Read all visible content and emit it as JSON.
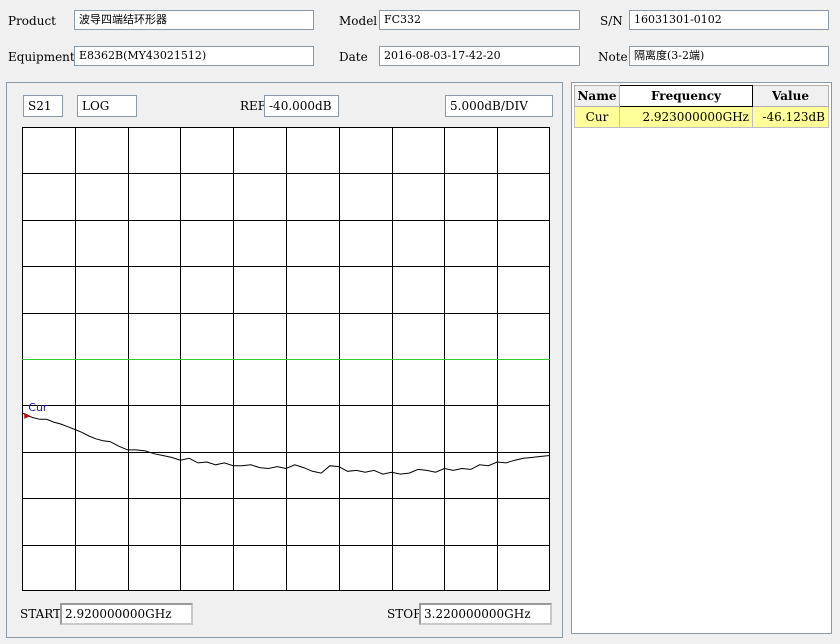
{
  "header": {
    "product_label": "Product",
    "product_value": "波导四端结环形器",
    "model_label": "Model",
    "model_value": "FC332",
    "sn_label": "S/N",
    "sn_value": "16031301-0102",
    "equipment_label": "Equipment",
    "equipment_value": "E8362B(MY43021512)",
    "date_label": "Date",
    "date_value": "2016-08-03-17-42-20",
    "note_label": "Note",
    "note_value": "隔离度(3-2端)"
  },
  "chart_header": {
    "param": "S21",
    "format": "LOG",
    "ref_label": "REF",
    "ref_value": "-40.000dB",
    "scale": "5.000dB/DIV"
  },
  "chart_footer": {
    "start_label": "START",
    "start_value": "2.920000000GHz",
    "stop_label": "STOP",
    "stop_value": "3.220000000GHz"
  },
  "colors": {
    "trace": "#000000",
    "reference_line": "#33cc33",
    "marker": "#cc0000",
    "marker_label": "#1a1ab4",
    "row_highlight": "#ffff99"
  },
  "chart_data": {
    "type": "line",
    "x_unit": "GHz",
    "y_unit": "dB",
    "xlim": [
      2.92,
      3.22
    ],
    "ylim": [
      -65,
      -15
    ],
    "x_divisions": 10,
    "y_divisions": 10,
    "reference_level": -40,
    "grid": true,
    "series": [
      {
        "x": [
          2.92,
          2.923,
          2.926,
          2.93,
          2.934,
          2.938,
          2.942,
          2.946,
          2.95,
          2.954,
          2.958,
          2.962,
          2.966,
          2.97,
          2.975,
          2.98,
          2.985,
          2.99,
          2.995,
          3.0,
          3.005,
          3.01,
          3.015,
          3.02,
          3.025,
          3.03,
          3.035,
          3.04,
          3.045,
          3.05,
          3.055,
          3.06,
          3.065,
          3.07,
          3.075,
          3.08,
          3.085,
          3.09,
          3.095,
          3.1,
          3.105,
          3.11,
          3.115,
          3.12,
          3.125,
          3.13,
          3.135,
          3.14,
          3.145,
          3.15,
          3.155,
          3.16,
          3.165,
          3.17,
          3.175,
          3.18,
          3.185,
          3.19,
          3.195,
          3.2,
          3.205,
          3.21,
          3.215,
          3.22
        ],
        "values": [
          -45.8,
          -46.1,
          -46.3,
          -46.5,
          -46.5,
          -46.8,
          -47.0,
          -47.3,
          -47.6,
          -47.9,
          -48.3,
          -48.6,
          -48.8,
          -48.9,
          -49.4,
          -49.8,
          -49.8,
          -49.9,
          -50.2,
          -50.4,
          -50.6,
          -50.9,
          -50.7,
          -51.2,
          -51.1,
          -51.4,
          -51.2,
          -51.5,
          -51.5,
          -51.4,
          -51.7,
          -51.8,
          -51.6,
          -51.8,
          -51.4,
          -51.7,
          -52.1,
          -52.3,
          -51.5,
          -51.6,
          -52.1,
          -52.0,
          -52.2,
          -52.0,
          -52.4,
          -52.2,
          -52.4,
          -52.3,
          -51.9,
          -52.0,
          -52.2,
          -51.8,
          -52.0,
          -51.8,
          -51.9,
          -51.4,
          -51.5,
          -51.1,
          -51.2,
          -50.9,
          -50.7,
          -50.6,
          -50.5,
          -50.4
        ]
      }
    ],
    "marker": {
      "label": "Cur",
      "x": 2.923,
      "y": -46.123
    }
  },
  "table": {
    "headers": [
      "Name",
      "Frequency",
      "Value"
    ],
    "rows": [
      {
        "name": "Cur",
        "frequency": "2.923000000GHz",
        "value": "-46.123dB"
      }
    ]
  }
}
